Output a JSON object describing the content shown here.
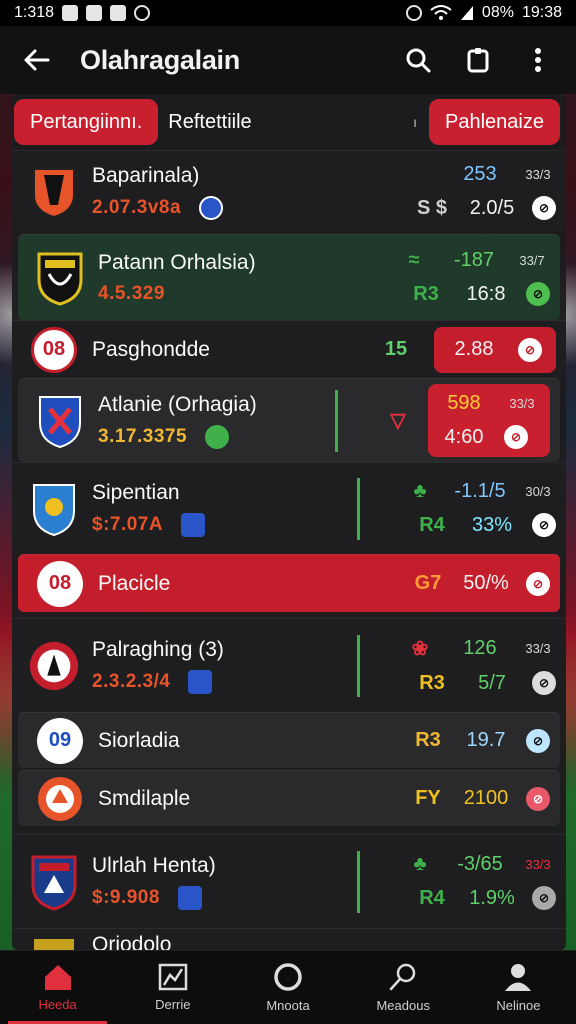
{
  "status_bar": {
    "time_left": "1:318",
    "battery": "08%",
    "time_right": "19:38"
  },
  "app_bar": {
    "title": "Olahragalain"
  },
  "filters": {
    "left_chip": "Pertangiinnı.",
    "left_label": "Reftettiile",
    "mid_mark": "ı",
    "right_chip": "Pahlenaize"
  },
  "rows": [
    {
      "name": "Baparinala)",
      "score": "2.07.3v8a",
      "a": "",
      "a2": "S $",
      "b": "253",
      "b2": "2.0/5",
      "c": "33/3",
      "dot": "⊘",
      "dot_color": "#ffffff",
      "badge_color": "#2a55c8"
    },
    {
      "name": "Patann Orhalsia)",
      "score": "4.5.329",
      "a": "",
      "a2": "R3",
      "b": "-187",
      "b2": "16:8",
      "c": "33/7",
      "dot": "⊘",
      "dot_color": "#4fbf4f",
      "badge_color": ""
    },
    {
      "name": "Pasghondde",
      "badge_num": "08",
      "a": "15",
      "b": "2.88",
      "dot": "⊘"
    },
    {
      "name": "Atlanie (Orhagia)",
      "score": "3.17.3375",
      "a2": "",
      "b": "598",
      "b2": "4:60",
      "c": "33/3",
      "dot": "⊘",
      "badge_color": "#3fb04a"
    },
    {
      "name": "Sipentian",
      "score": "$:7.07A",
      "a2": "R4",
      "b": "-1.1/5",
      "b2": "33%",
      "c": "30/3",
      "dot": "⊘",
      "badge_color": "#2a55c8"
    },
    {
      "name": "Placicle",
      "badge_num": "08",
      "a": "G7",
      "b": "50/%",
      "dot": "⊘"
    },
    {
      "name": "Palraghing (3)",
      "score": "2.3.2.3/4",
      "a2": "R3",
      "b": "126",
      "b2": "5/7",
      "c": "33/3",
      "dot": "⊘",
      "badge_color": "#2a55c8"
    },
    {
      "name": "Siorladia",
      "badge_num": "09",
      "a": "R3",
      "b": "19.7",
      "dot": "⊘"
    },
    {
      "name": "Smdilaple",
      "a": "FY",
      "b": "2100",
      "dot": "⊘"
    },
    {
      "name": "Ulrlah Henta)",
      "score": "$:9.908",
      "a2": "R4",
      "b": "-3/65",
      "b2": "1.9%",
      "c": "33/3",
      "dot": "⊘",
      "badge_color": "#2a55c8"
    },
    {
      "name": "Oriodolo"
    }
  ],
  "nav": [
    {
      "label": "Heeda",
      "icon": "home-icon"
    },
    {
      "label": "Derrie",
      "icon": "chart-icon"
    },
    {
      "label": "Mnoota",
      "icon": "circle-icon"
    },
    {
      "label": "Meadous",
      "icon": "search-icon"
    },
    {
      "label": "Nelinoe",
      "icon": "profile-icon"
    }
  ],
  "colors": {
    "accent": "#c41e2d",
    "green": "#3fb04a",
    "orange": "#e8542a"
  }
}
